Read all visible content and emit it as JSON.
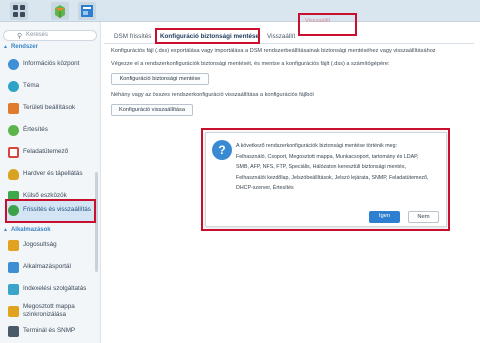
{
  "topbar": {
    "icons": [
      "grid-icon",
      "package-icon",
      "control-panel-icon"
    ]
  },
  "sidebar": {
    "search_placeholder": "Keresés",
    "sections": [
      {
        "label": "Rendszer"
      },
      {
        "label": "Alkalmazások"
      }
    ],
    "items": [
      {
        "label": "Információs központ",
        "icon": "info-icon",
        "color": "#3d8fd8"
      },
      {
        "label": "Téma",
        "icon": "palette-icon",
        "color": "#2fa3c7"
      },
      {
        "label": "Területi beállítások",
        "icon": "regional-icon",
        "color": "#e07a2c"
      },
      {
        "label": "Értesítés",
        "icon": "chat-icon",
        "color": "#59b54a"
      },
      {
        "label": "Feladatütemező",
        "icon": "calendar-icon",
        "color": "#d8453b"
      },
      {
        "label": "Hardver és tápellátás",
        "icon": "bulb-icon",
        "color": "#d9a322"
      },
      {
        "label": "Külső eszközök",
        "icon": "download-icon",
        "color": "#3ba84a"
      },
      {
        "label": "Frissítés és visszaállítás",
        "icon": "refresh-icon",
        "color": "#3aa24a"
      },
      {
        "label": "Jogosultság",
        "icon": "key-icon",
        "color": "#e0a21f"
      },
      {
        "label": "Alkalmazásportál",
        "icon": "portal-icon",
        "color": "#3b8fd2"
      },
      {
        "label": "Indexelési szolgáltatás",
        "icon": "index-icon",
        "color": "#3aa4c9"
      },
      {
        "label": "Megosztott mappa szinkronizálása",
        "icon": "sync-folder-icon",
        "color": "#e0a21f"
      },
      {
        "label": "Terminál és SNMP",
        "icon": "terminal-icon",
        "color": "#4a5a68"
      }
    ]
  },
  "tabs": [
    {
      "label": "DSM frissítés"
    },
    {
      "label": "Konfiguráció biztonsági mentése"
    },
    {
      "label": "Visszaállít"
    }
  ],
  "disabled_label": "Visszaállít",
  "main": {
    "line1": "Konfigurációs fájl (.dss) exportálása vagy importálása a DSM rendszerbeállításainak biztonsági mentéséhez vagy visszaállításához",
    "line2": "Végezze el a rendszerkonfigurációk biztonsági mentését, és mentse a konfigurációs fájlt (.dss) a számítógépére:",
    "backup_button": "Konfiguráció biztonsági mentése",
    "line3": "Néhány vagy az összes rendszerkonfiguráció visszaállítása a konfigurációs fájlból",
    "restore_button": "Konfiguráció visszaállítása"
  },
  "dialog": {
    "lines": [
      "A következő rendszerkonfigurációk biztonsági mentése történik meg:",
      "Felhasználó, Csoport, Megosztott mappa, Munkacsoport, tartomány és LDAP,",
      "SMB, AFP, NFS, FTP, Speciális, Hálózaton keresztüli biztonsági mentés,",
      "Felhasználói kezdőlap, Jelszóbeállítások, Jelszó lejárata, SNMP, Feladatütemező,",
      "DHCP-szerver, Értesítés"
    ],
    "yes_label": "Igen",
    "no_label": "Nem"
  }
}
